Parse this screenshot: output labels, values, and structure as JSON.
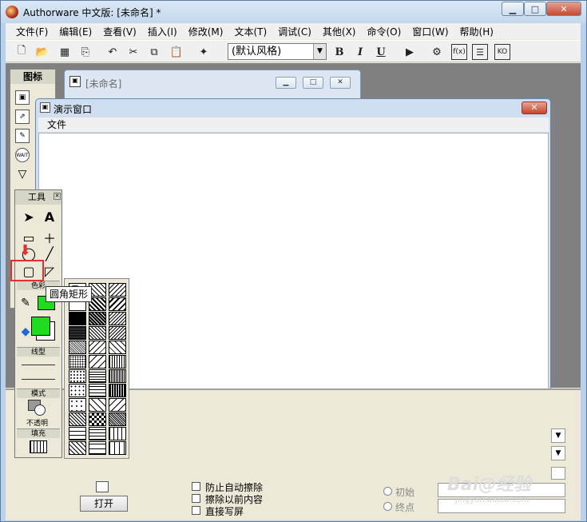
{
  "window": {
    "title": "Authorware 中文版: [未命名] *",
    "min": "▁",
    "max": "□",
    "close": "✕"
  },
  "menubar": {
    "items": [
      "文件(F)",
      "编辑(E)",
      "查看(V)",
      "插入(I)",
      "修改(M)",
      "文本(T)",
      "调试(C)",
      "其他(X)",
      "命令(O)",
      "窗口(W)",
      "帮助(H)"
    ]
  },
  "toolbar": {
    "style_select": "(默认风格)",
    "bold": "B",
    "italic": "I",
    "underline": "U"
  },
  "icon_palette": {
    "title": "图标"
  },
  "design_window": {
    "title": "[未命名]"
  },
  "presentation_window": {
    "title": "演示窗口",
    "menu_file": "文件",
    "close": "✕"
  },
  "tools": {
    "title": "工具",
    "color_label": "色彩",
    "line_label": "线型",
    "mode_label": "模式",
    "mode_value": "不透明",
    "fill_label": "填充",
    "pattern_none": "无",
    "fill_color": "#1fdc1f"
  },
  "tooltip": "圆角矩形",
  "properties": {
    "chk1": "防止自动擦除",
    "chk2": "擦除以前内容",
    "chk3": "直接写屏",
    "radio1": "初始",
    "radio2": "终点",
    "open": "打开"
  },
  "watermark": {
    "brand": "Bai@经验",
    "url": "jingyan.baidu.com"
  }
}
